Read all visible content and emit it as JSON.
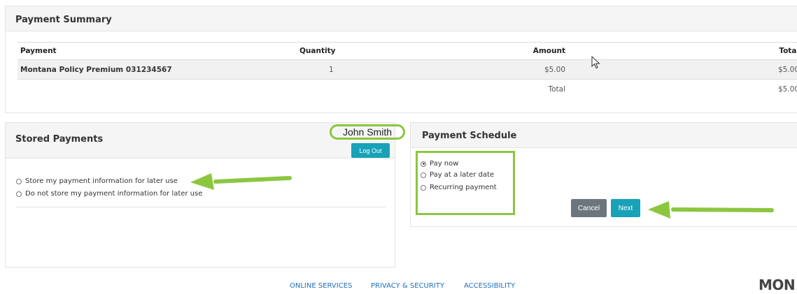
{
  "summary": {
    "title": "Payment Summary",
    "headers": {
      "payment": "Payment",
      "quantity": "Quantity",
      "amount": "Amount",
      "total": "Total"
    },
    "rows": [
      {
        "payment": "Montana Policy Premium 031234567",
        "quantity": "1",
        "amount": "$5.00",
        "total": "$5.00"
      }
    ],
    "total_label": "Total",
    "total_value": "$5.00"
  },
  "stored": {
    "title": "Stored Payments",
    "user_name": "John Smith",
    "logout_label": "Log Out",
    "options": [
      {
        "label": "Store my payment information for later use",
        "checked": false
      },
      {
        "label": "Do not store my payment information for later use",
        "checked": false
      }
    ]
  },
  "schedule": {
    "title": "Payment Schedule",
    "options": [
      {
        "label": "Pay now",
        "checked": true
      },
      {
        "label": "Pay at a later date",
        "checked": false
      },
      {
        "label": "Recurring payment",
        "checked": false
      }
    ],
    "cancel_label": "Cancel",
    "next_label": "Next"
  },
  "footer": {
    "links": [
      "ONLINE SERVICES",
      "PRIVACY & SECURITY",
      "ACCESSIBILITY"
    ],
    "brand": "MON"
  },
  "colors": {
    "highlight_green": "#8cc63f",
    "primary_teal": "#17a2b8",
    "secondary_gray": "#6c757d",
    "link_blue": "#1f6fb8"
  },
  "icons": [
    "arrow-pointer-icon",
    "mouse-cursor-icon"
  ]
}
